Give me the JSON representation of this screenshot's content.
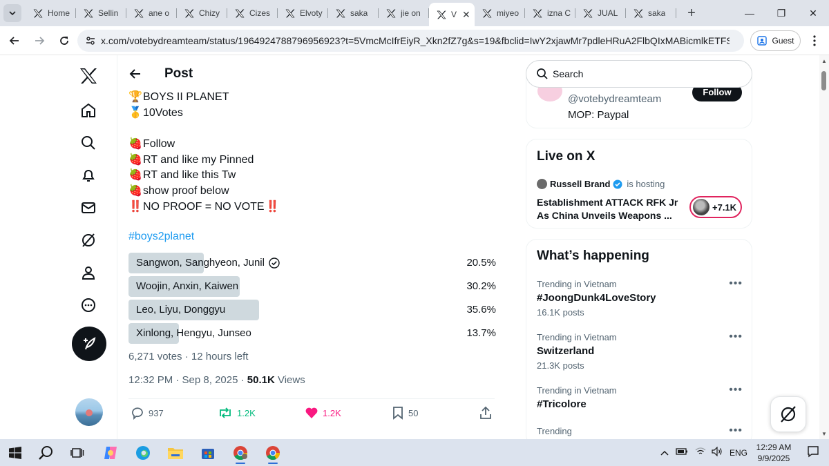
{
  "browser": {
    "tabs": [
      {
        "title": "Home"
      },
      {
        "title": "Sellin"
      },
      {
        "title": "ane o"
      },
      {
        "title": "Chizy"
      },
      {
        "title": "Cizes"
      },
      {
        "title": "Elvoty"
      },
      {
        "title": "saka"
      },
      {
        "title": "jie on"
      },
      {
        "title": "V",
        "active": true
      },
      {
        "title": "miyeo"
      },
      {
        "title": "izna C"
      },
      {
        "title": "JUAL"
      },
      {
        "title": "saka"
      }
    ],
    "url": "x.com/votebydreamteam/status/1964924788796956923?t=5VmcMcIfrEiyR_Xkn2fZ7g&s=19&fbclid=IwY2xjawMr7pdleHRuA2FlbQIxMABicmlkETFSNjdUSDl...",
    "profile_label": "Guest"
  },
  "post": {
    "header_title": "Post",
    "lines": [
      {
        "emoji": "🏆",
        "text": "BOYS II PLANET"
      },
      {
        "emoji": "🥇",
        "text": "10Votes"
      },
      {
        "gap": true
      },
      {
        "emoji": "🍓",
        "text": "Follow"
      },
      {
        "emoji": "🍓",
        "text": "RT and like my Pinned"
      },
      {
        "emoji": "🍓",
        "text": "RT and like this Tw"
      },
      {
        "emoji": "🍓",
        "text": "show proof below"
      },
      {
        "emoji": "‼️",
        "text": "NO PROOF = NO VOTE",
        "suffix": "‼️"
      }
    ],
    "hashtag": "#boys2planet",
    "poll": {
      "options": [
        {
          "label": "Sangwon, Sanghyeon, Junil",
          "percent_text": "20.5%",
          "percent": 20.5,
          "selected": true
        },
        {
          "label": "Woojin, Anxin, Kaiwen",
          "percent_text": "30.2%",
          "percent": 30.2
        },
        {
          "label": "Leo, Liyu, Donggyu",
          "percent_text": "35.6%",
          "percent": 35.6
        },
        {
          "label": "Xinlong, Hengyu, Junseo",
          "percent_text": "13.7%",
          "percent": 13.7
        }
      ],
      "meta": "6,271 votes · 12 hours left"
    },
    "timestamp": "12:32 PM · Sep 8, 2025 · ",
    "views_count": "50.1K",
    "views_label": " Views",
    "actions": {
      "replies": "937",
      "reposts": "1.2K",
      "likes": "1.2K",
      "bookmarks": "50"
    },
    "colors": {
      "repost": "#00ba7c",
      "like": "#f91880",
      "link": "#1d9bf0"
    }
  },
  "sidebar": {
    "search_placeholder": "Search",
    "who_to_follow": {
      "handle": "@votebydreamteam",
      "bio": "MOP: Paypal",
      "follow_label": "Follow"
    },
    "live": {
      "title": "Live on X",
      "host_name": "Russell Brand",
      "host_suffix": "is hosting",
      "space_title": "Establishment ATTACK RFK Jr As China Unveils Weapons ...",
      "listeners": "+7.1K"
    },
    "happening": {
      "title": "What’s happening",
      "trends": [
        {
          "context": "Trending in Vietnam",
          "name": "#JoongDunk4LoveStory",
          "posts": "16.1K posts"
        },
        {
          "context": "Trending in Vietnam",
          "name": "Switzerland",
          "posts": "21.3K posts"
        },
        {
          "context": "Trending in Vietnam",
          "name": "#Tricolore",
          "posts": ""
        },
        {
          "context": "Trending",
          "name": "",
          "posts": ""
        }
      ]
    }
  },
  "taskbar": {
    "language": "ENG",
    "time": "12:29 AM",
    "date": "9/9/2025"
  }
}
